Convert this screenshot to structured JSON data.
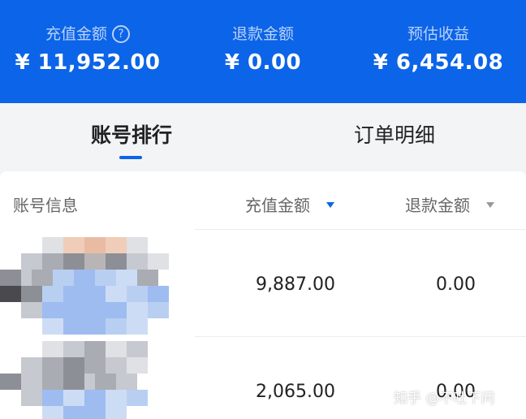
{
  "summary": {
    "recharge": {
      "label": "充值金额",
      "value": "¥ 11,952.00",
      "help": "?"
    },
    "refund": {
      "label": "退款金额",
      "value": "¥ 0.00"
    },
    "estimated": {
      "label": "预估收益",
      "value": "¥ 6,454.08"
    }
  },
  "tabs": [
    {
      "label": "账号排行",
      "active": true
    },
    {
      "label": "订单明细",
      "active": false
    }
  ],
  "table": {
    "columns": {
      "account": "账号信息",
      "recharge": "充值金额",
      "refund": "退款金额"
    },
    "sort": {
      "recharge": "descending-active",
      "refund": "inactive"
    },
    "rows": [
      {
        "recharge": "9,887.00",
        "refund": "0.00"
      },
      {
        "recharge": "2,065.00",
        "refund": "0.00"
      }
    ]
  },
  "watermark": "知乎 @不吐下问",
  "colors": {
    "primary": "#0c64e8",
    "header_label": "#b8d1fb",
    "page_bg": "#f3f4f6"
  }
}
